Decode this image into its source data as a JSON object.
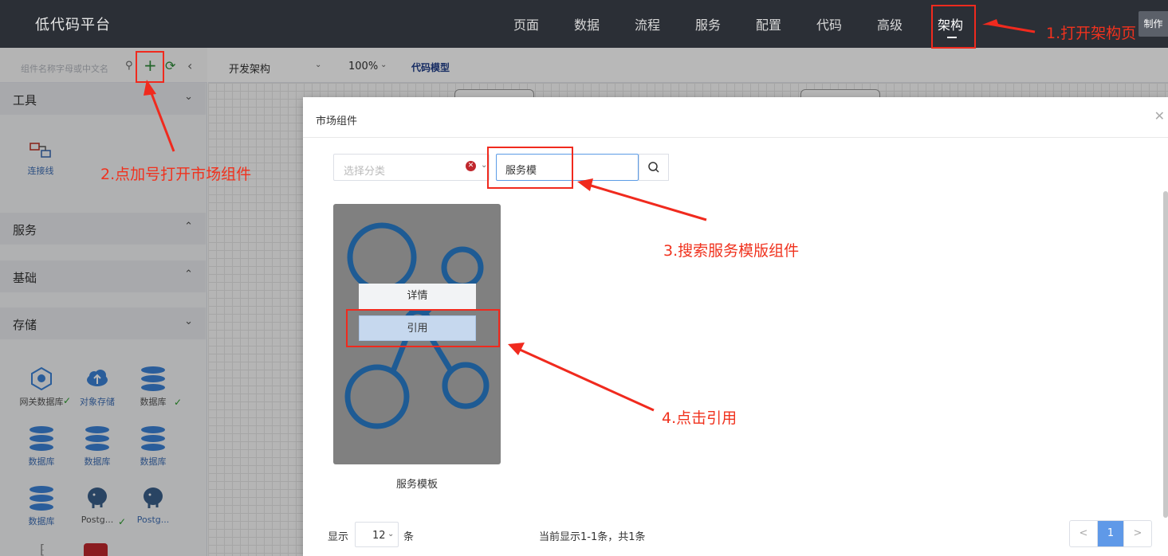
{
  "app": {
    "title": "低代码平台"
  },
  "nav": {
    "items": [
      "页面",
      "数据",
      "流程",
      "服务",
      "配置",
      "代码",
      "高级",
      "架构"
    ],
    "active": "架构",
    "make_button": "制作"
  },
  "left": {
    "search_placeholder": "组件名称字母或中文名",
    "sections": [
      {
        "title": "工具",
        "expanded": true
      },
      {
        "title": "服务",
        "expanded": false
      },
      {
        "title": "基础",
        "expanded": false
      },
      {
        "title": "存储",
        "expanded": true
      }
    ],
    "tool_items": [
      "连接线"
    ],
    "storage_items": [
      "网关数据库",
      "对象存储",
      "数据库",
      "数据库",
      "数据库",
      "数据库",
      "数据库",
      "Postg...",
      "Postg..."
    ]
  },
  "toolbar": {
    "arch_select": "开发架构",
    "zoom": "100%",
    "code_model": "代码模型"
  },
  "modal": {
    "title": "市场组件",
    "category_placeholder": "选择分类",
    "search_value": "服务模",
    "card": {
      "title": "服务模板",
      "detail_label": "详情",
      "ref_label": "引用"
    },
    "footer": {
      "show_label": "显示",
      "page_size": "12",
      "unit_label": "条",
      "summary": "当前显示1-1条，共1条",
      "prev": "<",
      "current_page": "1",
      "next": ">"
    }
  },
  "annotations": {
    "step1": "1.打开架构页",
    "step2": "2.点加号打开市场组件",
    "step3": "3.搜索服务模版组件",
    "step4": "4.点击引用"
  },
  "colors": {
    "highlight": "#f02a1e",
    "topbar": "#2b2f36",
    "accent": "#5f99e8"
  }
}
